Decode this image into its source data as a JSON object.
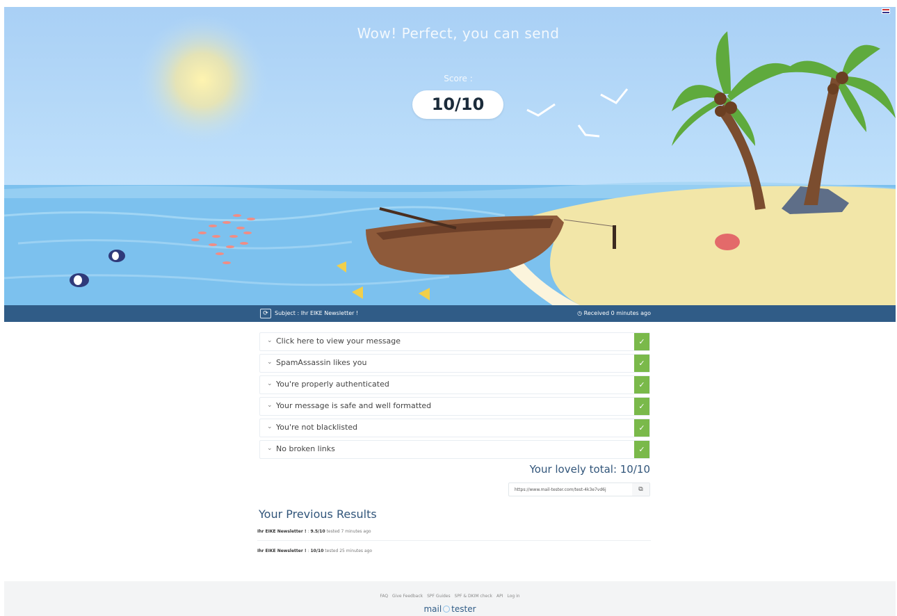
{
  "hero": {
    "title": "Wow! Perfect, you can send",
    "score_label": "Score :",
    "score": "10/10"
  },
  "subject_bar": {
    "refresh_icon": "refresh-icon",
    "subject": "Subject : Ihr EIKE Newsletter !",
    "received": "Received 0 minutes ago"
  },
  "checks": [
    {
      "label": "Click here to view your message",
      "status": "pass"
    },
    {
      "label": "SpamAssassin likes you",
      "status": "pass"
    },
    {
      "label": "You're properly authenticated",
      "status": "pass"
    },
    {
      "label": "Your message is safe and well formatted",
      "status": "pass"
    },
    {
      "label": "You're not blacklisted",
      "status": "pass"
    },
    {
      "label": "No broken links",
      "status": "pass"
    }
  ],
  "check_mark": "✓",
  "chevron": "⌄",
  "total": "Your lovely total: 10/10",
  "share": {
    "value": "https://www.mail-tester.com/test-4k3e7vd6j",
    "copy_icon": "copy-icon"
  },
  "previous": {
    "title": "Your Previous Results",
    "items": [
      {
        "name": "Ihr EIKE Newsletter !",
        "mid": " : ",
        "score": "9.5/10",
        "rest": " tested 7 minutes ago"
      },
      {
        "name": "Ihr EIKE Newsletter !",
        "mid": " : ",
        "score": "10/10",
        "rest": " tested 25 minutes ago"
      }
    ]
  },
  "footer": {
    "links": [
      "FAQ",
      "Give Feedback",
      "SPF Guides",
      "SPF & DKIM check",
      "API",
      "Log in"
    ],
    "logo_left": "mail",
    "logo_right": "tester"
  },
  "colors": {
    "bar": "#305c87",
    "pass": "#7ab94a",
    "heading": "#31557a"
  }
}
